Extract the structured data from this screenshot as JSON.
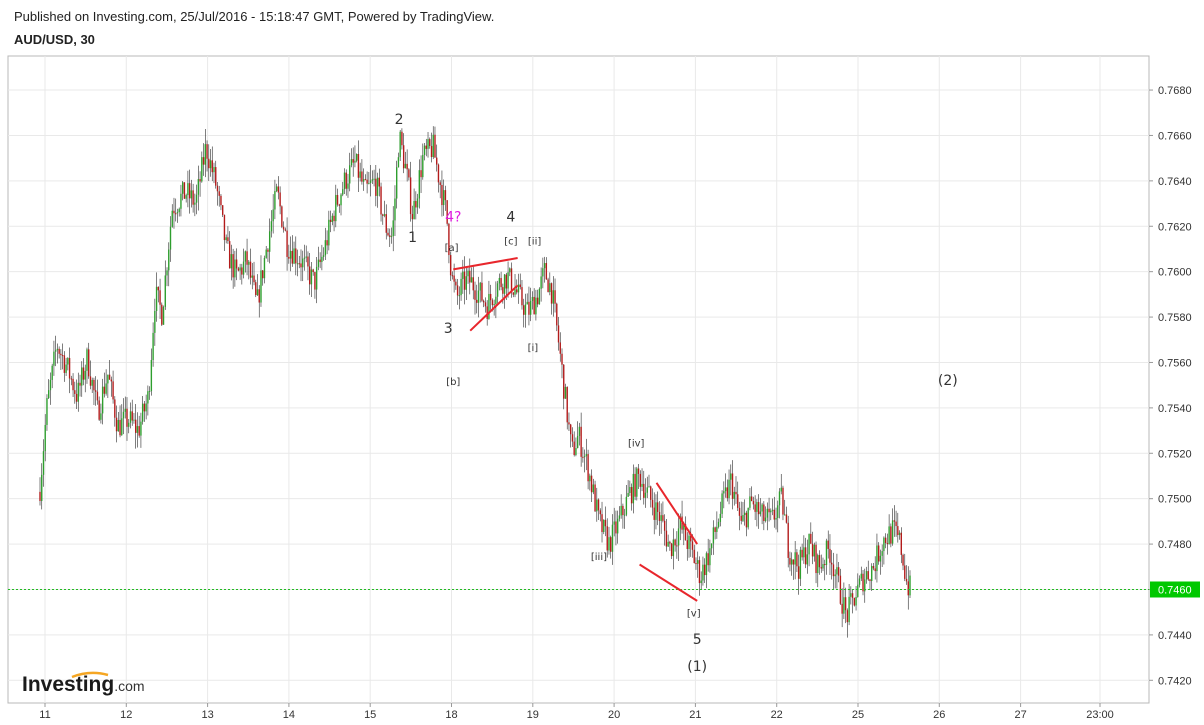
{
  "header": {
    "published": "Published on Investing.com, 25/Jul/2016 - 15:18:47 GMT, Powered by TradingView.",
    "symbol": "AUD/USD, 30"
  },
  "logo": {
    "main": "Investing",
    "suffix": ".com"
  },
  "colors": {
    "up": "#2e9e2e",
    "down": "#b31b1b",
    "wick": "#2a2a2a",
    "price_line": "#22bb22",
    "price_badge": "#00c800",
    "grid": "#e9e9e9",
    "annotation_line": "#e8262c",
    "magenta_label": "#e020e0"
  },
  "chart_data": {
    "type": "candlestick",
    "title": "AUD/USD, 30",
    "interval_minutes": 30,
    "y_axis": {
      "position": "right",
      "range": [
        0.741,
        0.7695
      ],
      "ticks": [
        "0.7420",
        "0.7440",
        "0.7460",
        "0.7480",
        "0.7500",
        "0.7520",
        "0.7540",
        "0.7560",
        "0.7580",
        "0.7600",
        "0.7620",
        "0.7640",
        "0.7660",
        "0.7680"
      ]
    },
    "x_axis": {
      "ticks": [
        "11",
        "12",
        "13",
        "14",
        "15",
        "18",
        "19",
        "20",
        "21",
        "22",
        "25",
        "26",
        "27",
        "23:00"
      ],
      "trading_days": [
        "2016-07-11",
        "2016-07-12",
        "2016-07-13",
        "2016-07-14",
        "2016-07-15",
        "2016-07-18",
        "2016-07-19",
        "2016-07-20",
        "2016-07-21",
        "2016-07-22",
        "2016-07-25"
      ]
    },
    "grid": true,
    "last_price": {
      "value": 0.746,
      "label": "0.7460"
    },
    "path": [
      [
        "2016-07-10 22:00",
        0.7505
      ],
      [
        "2016-07-11 00:00",
        0.754
      ],
      [
        "2016-07-11 03:00",
        0.7568
      ],
      [
        "2016-07-11 06:00",
        0.7558
      ],
      [
        "2016-07-11 09:00",
        0.7545
      ],
      [
        "2016-07-11 12:00",
        0.7562
      ],
      [
        "2016-07-11 15:00",
        0.7538
      ],
      [
        "2016-07-11 18:00",
        0.7555
      ],
      [
        "2016-07-11 21:00",
        0.7532
      ],
      [
        "2016-07-12 00:00",
        0.7535
      ],
      [
        "2016-07-12 03:00",
        0.753
      ],
      [
        "2016-07-12 06:00",
        0.7545
      ],
      [
        "2016-07-12 08:00",
        0.759
      ],
      [
        "2016-07-12 10:00",
        0.7582
      ],
      [
        "2016-07-12 13:00",
        0.7628
      ],
      [
        "2016-07-12 17:00",
        0.7635
      ],
      [
        "2016-07-12 20:00",
        0.763
      ],
      [
        "2016-07-12 23:00",
        0.7655
      ],
      [
        "2016-07-13 02:00",
        0.7638
      ],
      [
        "2016-07-13 05:00",
        0.761
      ],
      [
        "2016-07-13 08:00",
        0.7598
      ],
      [
        "2016-07-13 11:00",
        0.7605
      ],
      [
        "2016-07-13 14:00",
        0.7585
      ],
      [
        "2016-07-13 17:00",
        0.7612
      ],
      [
        "2016-07-13 20:00",
        0.7635
      ],
      [
        "2016-07-13 23:00",
        0.7612
      ],
      [
        "2016-07-14 03:00",
        0.7605
      ],
      [
        "2016-07-14 07:00",
        0.7595
      ],
      [
        "2016-07-14 10:00",
        0.761
      ],
      [
        "2016-07-14 13:00",
        0.7628
      ],
      [
        "2016-07-14 16:00",
        0.764
      ],
      [
        "2016-07-14 19:00",
        0.7648
      ],
      [
        "2016-07-14 22:00",
        0.7635
      ],
      [
        "2016-07-15 01:00",
        0.764
      ],
      [
        "2016-07-15 04:00",
        0.762
      ],
      [
        "2016-07-15 06:00",
        0.7615
      ],
      [
        "2016-07-15 08:00",
        0.766
      ],
      [
        "2016-07-15 10:00",
        0.7645
      ],
      [
        "2016-07-15 12:00",
        0.7625
      ],
      [
        "2016-07-15 15:00",
        0.765
      ],
      [
        "2016-07-15 18:00",
        0.7655
      ],
      [
        "2016-07-15 20:00",
        0.764
      ],
      [
        "2016-07-17 22:00",
        0.7625
      ],
      [
        "2016-07-17 23:30",
        0.7598
      ],
      [
        "2016-07-18 01:00",
        0.7588
      ],
      [
        "2016-07-18 03:00",
        0.7595
      ],
      [
        "2016-07-18 05:00",
        0.7596
      ],
      [
        "2016-07-18 08:00",
        0.759
      ],
      [
        "2016-07-18 10:00",
        0.7585
      ],
      [
        "2016-07-18 13:00",
        0.7594
      ],
      [
        "2016-07-18 16:00",
        0.7598
      ],
      [
        "2016-07-18 19:00",
        0.759
      ],
      [
        "2016-07-18 22:00",
        0.7582
      ],
      [
        "2016-07-19 01:00",
        0.759
      ],
      [
        "2016-07-19 03:00",
        0.76
      ],
      [
        "2016-07-19 05:00",
        0.7592
      ],
      [
        "2016-07-19 07:00",
        0.757
      ],
      [
        "2016-07-19 09:00",
        0.7545
      ],
      [
        "2016-07-19 11:00",
        0.752
      ],
      [
        "2016-07-19 13:00",
        0.7528
      ],
      [
        "2016-07-19 16:00",
        0.7512
      ],
      [
        "2016-07-19 19:00",
        0.749
      ],
      [
        "2016-07-19 22:00",
        0.748
      ],
      [
        "2016-07-20 01:00",
        0.749
      ],
      [
        "2016-07-20 04:00",
        0.7502
      ],
      [
        "2016-07-20 07:00",
        0.751
      ],
      [
        "2016-07-20 10:00",
        0.75
      ],
      [
        "2016-07-20 13:00",
        0.7492
      ],
      [
        "2016-07-20 16:00",
        0.7478
      ],
      [
        "2016-07-20 19:00",
        0.7488
      ],
      [
        "2016-07-20 22:00",
        0.7478
      ],
      [
        "2016-07-21 01:00",
        0.7466
      ],
      [
        "2016-07-21 04:00",
        0.7478
      ],
      [
        "2016-07-21 07:00",
        0.7495
      ],
      [
        "2016-07-21 10:00",
        0.7508
      ],
      [
        "2016-07-21 13:00",
        0.7488
      ],
      [
        "2016-07-21 16:00",
        0.7498
      ],
      [
        "2016-07-21 19:00",
        0.7492
      ],
      [
        "2016-07-21 22:00",
        0.749
      ],
      [
        "2016-07-22 01:00",
        0.75
      ],
      [
        "2016-07-22 03:00",
        0.7478
      ],
      [
        "2016-07-22 06:00",
        0.747
      ],
      [
        "2016-07-22 09:00",
        0.748
      ],
      [
        "2016-07-22 12:00",
        0.747
      ],
      [
        "2016-07-22 15:00",
        0.7478
      ],
      [
        "2016-07-22 18:00",
        0.746
      ],
      [
        "2016-07-22 20:00",
        0.7448
      ],
      [
        "2016-07-24 22:00",
        0.7455
      ],
      [
        "2016-07-25 01:00",
        0.7465
      ],
      [
        "2016-07-25 04:00",
        0.747
      ],
      [
        "2016-07-25 07:00",
        0.7482
      ],
      [
        "2016-07-25 10:00",
        0.7486
      ],
      [
        "2016-07-25 12:00",
        0.748
      ],
      [
        "2016-07-25 14:00",
        0.7462
      ],
      [
        "2016-07-25 15:00",
        0.746
      ]
    ],
    "annotations": {
      "wave_labels": [
        {
          "text": "2",
          "time": "2016-07-15 08:00",
          "price": 0.7665,
          "size": "large"
        },
        {
          "text": "1",
          "time": "2016-07-15 12:00",
          "price": 0.7613,
          "size": "large"
        },
        {
          "text": "4?",
          "time": "2016-07-18 00:00",
          "price": 0.7622,
          "size": "large",
          "color": "magenta"
        },
        {
          "text": "4",
          "time": "2016-07-18 17:00",
          "price": 0.7622,
          "size": "large"
        },
        {
          "text": "[a]",
          "time": "2016-07-17 23:30",
          "price": 0.7609,
          "size": "small"
        },
        {
          "text": "[c]",
          "time": "2016-07-18 17:00",
          "price": 0.7612,
          "size": "small"
        },
        {
          "text": "[ii]",
          "time": "2016-07-19 00:00",
          "price": 0.7612,
          "size": "small"
        },
        {
          "text": "3",
          "time": "2016-07-17 22:30",
          "price": 0.7573,
          "size": "large"
        },
        {
          "text": "[b]",
          "time": "2016-07-18 00:00",
          "price": 0.755,
          "size": "small"
        },
        {
          "text": "[i]",
          "time": "2016-07-18 23:30",
          "price": 0.7565,
          "size": "small"
        },
        {
          "text": "[iv]",
          "time": "2016-07-20 06:00",
          "price": 0.7523,
          "size": "small"
        },
        {
          "text": "[iii]",
          "time": "2016-07-19 19:00",
          "price": 0.7473,
          "size": "small"
        },
        {
          "text": "[v]",
          "time": "2016-07-20 23:00",
          "price": 0.7448,
          "size": "small"
        },
        {
          "text": "5",
          "time": "2016-07-21 00:00",
          "price": 0.7436,
          "size": "large"
        },
        {
          "text": "(1)",
          "time": "2016-07-21 00:00",
          "price": 0.7424,
          "size": "large"
        },
        {
          "text": "(2)",
          "time": "2016-07-26 02:00",
          "price": 0.755,
          "size": "large"
        }
      ],
      "trend_lines": [
        {
          "from": [
            "2016-07-18 00:00",
            0.7601
          ],
          "to": [
            "2016-07-18 19:00",
            0.7606
          ]
        },
        {
          "from": [
            "2016-07-18 05:00",
            0.7574
          ],
          "to": [
            "2016-07-18 19:00",
            0.7594
          ]
        },
        {
          "from": [
            "2016-07-20 12:00",
            0.7507
          ],
          "to": [
            "2016-07-21 00:00",
            0.748
          ]
        },
        {
          "from": [
            "2016-07-20 07:00",
            0.7471
          ],
          "to": [
            "2016-07-21 00:00",
            0.7455
          ]
        }
      ]
    }
  }
}
